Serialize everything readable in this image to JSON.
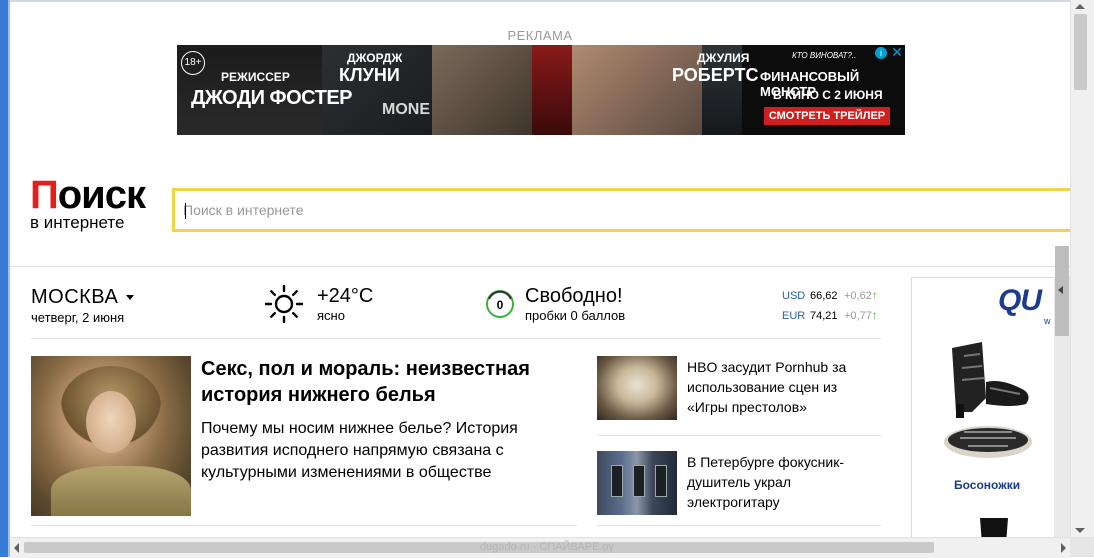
{
  "ad": {
    "label": "РЕКЛАМА",
    "age_badge": "18+",
    "director_top": "РЕЖИССЕР",
    "director_name": "ДЖОДИ ФОСТЕР",
    "actor1_top": "ДЖОРДЖ",
    "actor1_name": "КЛУНИ",
    "poster_text": "MONE",
    "actor2_top": "ДЖУЛИЯ",
    "actor2_name": "РОБЕРТС",
    "tagline": "КТО ВИНОВАТ?..",
    "movie_title": "ФИНАНСОВЫЙ МОНСТР",
    "release": "В КИНО С 2 ИЮНЯ",
    "cta": "СМОТРЕТЬ ТРЕЙЛЕР",
    "info_icon": "i",
    "close_icon": "✕"
  },
  "logo": {
    "main_first": "П",
    "main_rest": "оиск",
    "sub": "в интернете"
  },
  "search": {
    "placeholder": "Поиск в интернете",
    "value": ""
  },
  "location": {
    "city": "МОСКВА",
    "date": "четверг, 2 июня"
  },
  "weather": {
    "temp": "+24°С",
    "desc": "ясно",
    "icon": "sun-icon"
  },
  "traffic": {
    "score": "0",
    "title": "Свободно!",
    "subtitle": "пробки 0 баллов",
    "color": "#3bb03b"
  },
  "rates": [
    {
      "code": "USD",
      "value": "66,62",
      "change": "+0,62",
      "arrow": "↑"
    },
    {
      "code": "EUR",
      "value": "74,21",
      "change": "+0,77",
      "arrow": "↑"
    }
  ],
  "main_news": {
    "title": "Секс, пол и мораль: неизвестная история нижнего белья",
    "lead": "Почему мы носим нижнее белье? История развития исподнего напрямую связана с культурными изменениями в обществе"
  },
  "side_news": [
    {
      "title": "HBO засудит Pornhub за использование сцен из «Игры престолов»"
    },
    {
      "title": "В Петербурге фокусник-душитель украл электрогитару"
    }
  ],
  "right_ad": {
    "brand": "QU",
    "brand_sub": "w",
    "item_label": "Босоножки"
  },
  "watermark": "dugado.ru - СПАЙВАРЕ.ру",
  "colors": {
    "logo_red": "#e41d1d",
    "search_border": "#f2d543",
    "rate_code": "#2a5ea8",
    "brand_blue": "#1d3b8c"
  }
}
